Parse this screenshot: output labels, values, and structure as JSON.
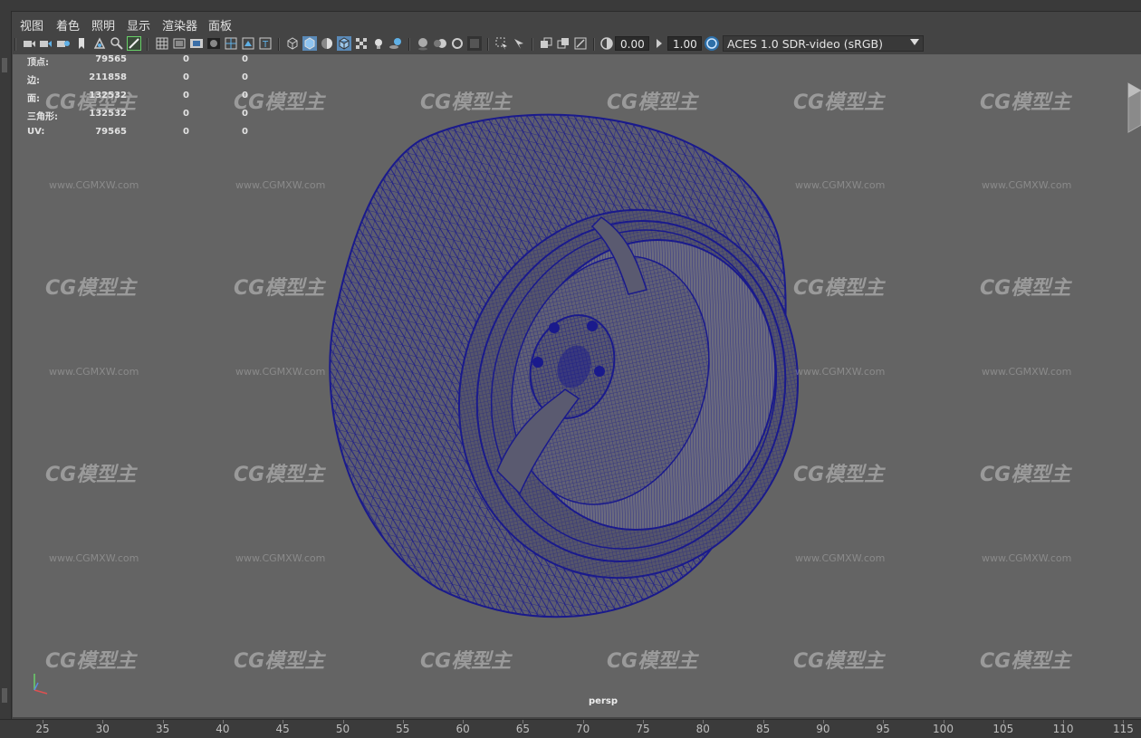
{
  "menubar": {
    "items": [
      {
        "label": "视图"
      },
      {
        "label": "着色"
      },
      {
        "label": "照明"
      },
      {
        "label": "显示"
      },
      {
        "label": "渲染器"
      },
      {
        "label": "面板"
      }
    ]
  },
  "toolbar": {
    "exposure_value": "0.00",
    "gamma_value": "1.00",
    "color_space": "ACES 1.0 SDR-video (sRGB)"
  },
  "hud": {
    "rows": [
      {
        "label": "顶点:",
        "v1": "79565",
        "v2": "0",
        "v3": "0"
      },
      {
        "label": "边:",
        "v1": "211858",
        "v2": "0",
        "v3": "0"
      },
      {
        "label": "面:",
        "v1": "132532",
        "v2": "0",
        "v3": "0"
      },
      {
        "label": "三角形:",
        "v1": "132532",
        "v2": "0",
        "v3": "0"
      },
      {
        "label": "UV:",
        "v1": "79565",
        "v2": "0",
        "v3": "0"
      }
    ]
  },
  "viewport": {
    "camera_label": "persp",
    "watermark_logo": "CG模型主",
    "watermark_url": "www.CGMXW.com",
    "wire_color": "#1a1a8c"
  },
  "timeline": {
    "ticks": [
      "25",
      "30",
      "35",
      "40",
      "45",
      "50",
      "55",
      "60",
      "65",
      "70",
      "75",
      "80",
      "85",
      "90",
      "95",
      "100",
      "105",
      "110",
      "115"
    ]
  }
}
